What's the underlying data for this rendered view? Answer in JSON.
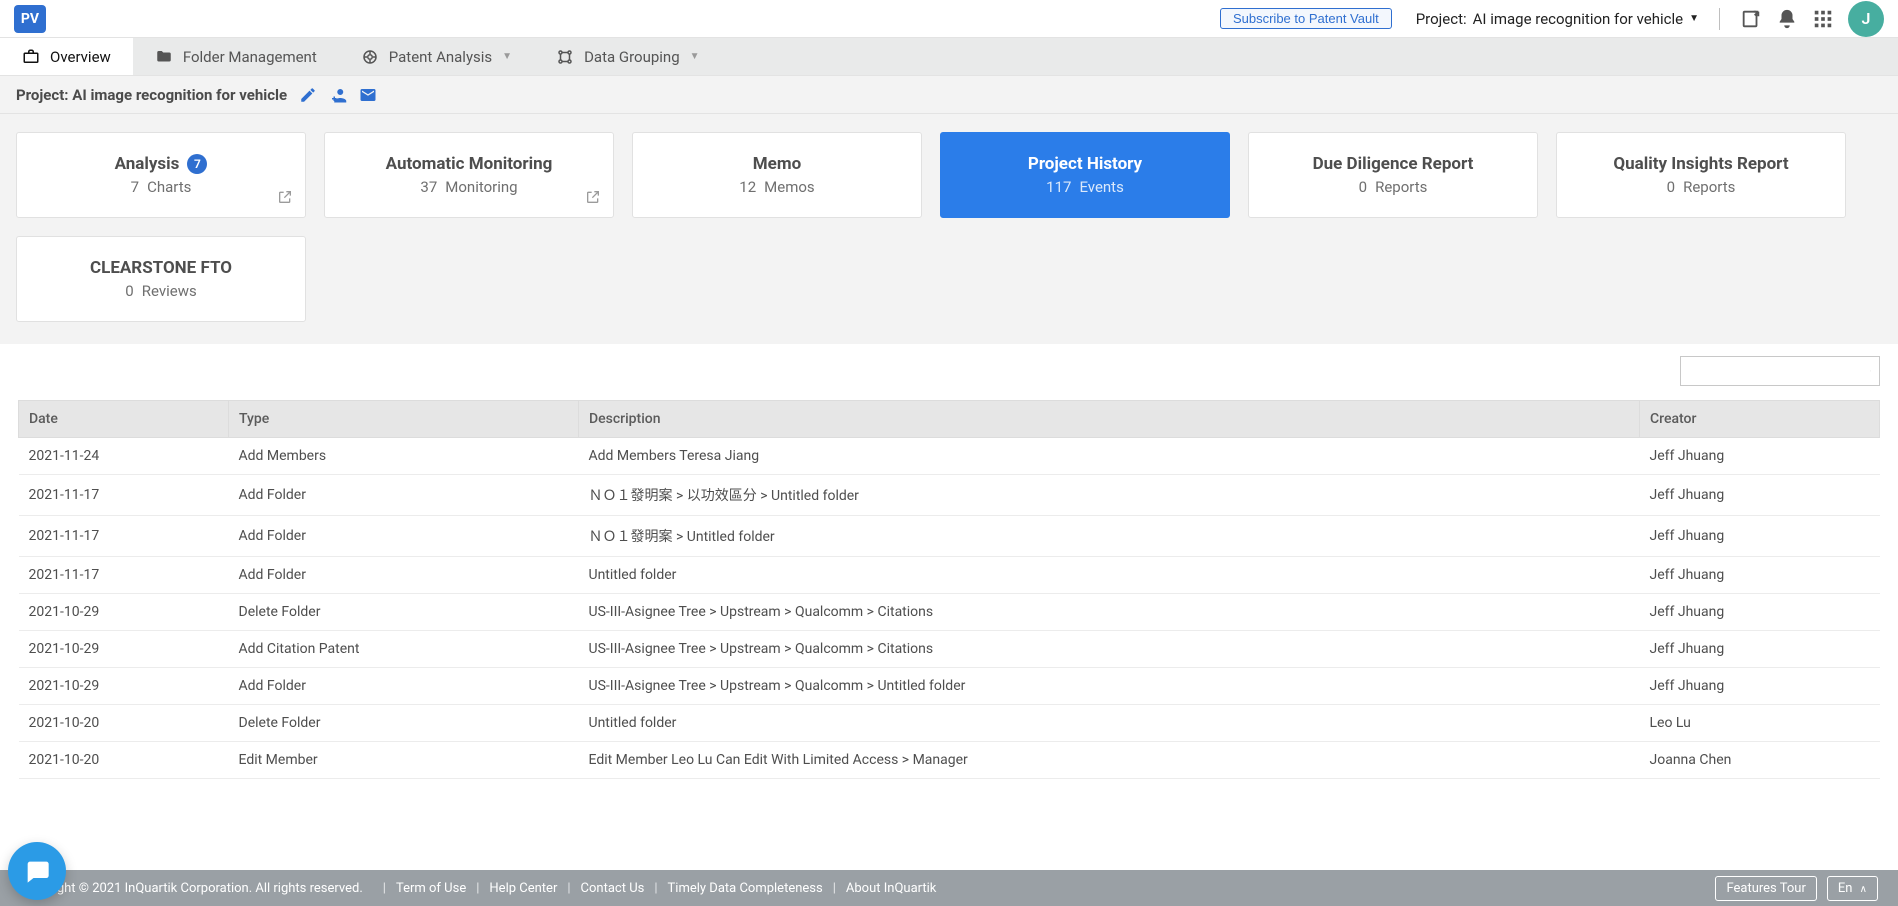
{
  "topbar": {
    "logo_text": "PV",
    "subscribe_label": "Subscribe to Patent Vault",
    "project_prefix": "Project:",
    "project_name": "AI image recognition for vehicle",
    "avatar_letter": "J"
  },
  "mainnav": {
    "tabs": [
      {
        "label": "Overview",
        "active": true,
        "has_caret": false,
        "icon": "briefcase"
      },
      {
        "label": "Folder Management",
        "active": false,
        "has_caret": false,
        "icon": "folder"
      },
      {
        "label": "Patent Analysis",
        "active": false,
        "has_caret": true,
        "icon": "radar"
      },
      {
        "label": "Data Grouping",
        "active": false,
        "has_caret": true,
        "icon": "group"
      }
    ]
  },
  "pagehead": {
    "title": "Project: AI image recognition for vehicle"
  },
  "cards": [
    {
      "title": "Analysis",
      "badge": "7",
      "count": "7",
      "unit": "Charts",
      "popout": true,
      "primary": false
    },
    {
      "title": "Automatic Monitoring",
      "badge": null,
      "count": "37",
      "unit": "Monitoring",
      "popout": true,
      "primary": false
    },
    {
      "title": "Memo",
      "badge": null,
      "count": "12",
      "unit": "Memos",
      "popout": false,
      "primary": false
    },
    {
      "title": "Project History",
      "badge": null,
      "count": "117",
      "unit": "Events",
      "popout": false,
      "primary": true
    },
    {
      "title": "Due Diligence Report",
      "badge": null,
      "count": "0",
      "unit": "Reports",
      "popout": false,
      "primary": false
    },
    {
      "title": "Quality Insights Report",
      "badge": null,
      "count": "0",
      "unit": "Reports",
      "popout": false,
      "primary": false
    },
    {
      "title": "CLEARSTONE FTO",
      "badge": null,
      "count": "0",
      "unit": "Reviews",
      "popout": false,
      "primary": false
    }
  ],
  "table": {
    "headers": {
      "date": "Date",
      "type": "Type",
      "desc": "Description",
      "creator": "Creator"
    },
    "rows": [
      {
        "date": "2021-11-24",
        "type": "Add Members",
        "desc": "Add Members  Teresa Jiang",
        "creator": "Jeff Jhuang"
      },
      {
        "date": "2021-11-17",
        "type": "Add Folder",
        "desc": "ＮＯ１發明案 > 以功效區分 > Untitled folder",
        "creator": "Jeff Jhuang"
      },
      {
        "date": "2021-11-17",
        "type": "Add Folder",
        "desc": "ＮＯ１發明案 > Untitled folder",
        "creator": "Jeff Jhuang"
      },
      {
        "date": "2021-11-17",
        "type": "Add Folder",
        "desc": "Untitled folder",
        "creator": "Jeff Jhuang"
      },
      {
        "date": "2021-10-29",
        "type": "Delete Folder",
        "desc": "US-III-Asignee Tree > Upstream > Qualcomm > Citations",
        "creator": "Jeff Jhuang"
      },
      {
        "date": "2021-10-29",
        "type": "Add Citation Patent",
        "desc": "US-III-Asignee Tree > Upstream > Qualcomm > Citations",
        "creator": "Jeff Jhuang"
      },
      {
        "date": "2021-10-29",
        "type": "Add Folder",
        "desc": "US-III-Asignee Tree > Upstream > Qualcomm > Untitled folder",
        "creator": "Jeff Jhuang"
      },
      {
        "date": "2021-10-20",
        "type": "Delete Folder",
        "desc": "Untitled folder",
        "creator": "Leo Lu"
      },
      {
        "date": "2021-10-20",
        "type": "Edit Member",
        "desc": "Edit Member  Leo Lu  Can Edit With Limited Access  >  Manager",
        "creator": "Joanna Chen"
      }
    ]
  },
  "footer": {
    "copyright": "Copyright © 2021 InQuartik Corporation. All rights reserved.",
    "links": [
      "Term of Use",
      "Help Center",
      "Contact Us",
      "Timely Data Completeness",
      "About InQuartik"
    ],
    "features_tour": "Features Tour",
    "lang": "En"
  }
}
